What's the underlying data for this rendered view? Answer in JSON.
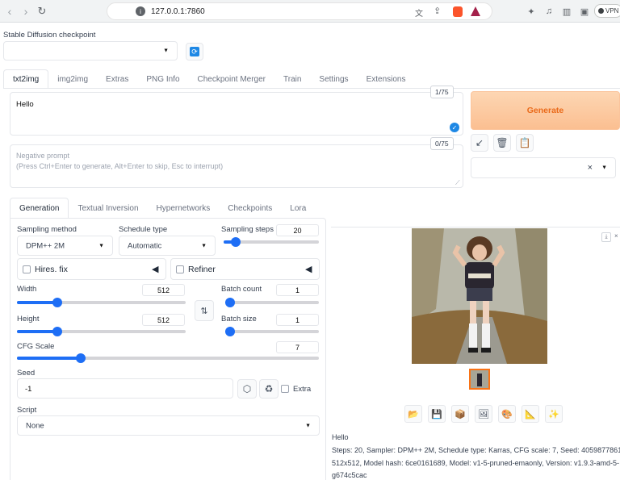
{
  "browser": {
    "url": "127.0.0.1:7860",
    "vpn_label": "VPN"
  },
  "checkpoint": {
    "label": "Stable Diffusion checkpoint",
    "value": ""
  },
  "main_tabs": [
    {
      "label": "txt2img"
    },
    {
      "label": "img2img"
    },
    {
      "label": "Extras"
    },
    {
      "label": "PNG Info"
    },
    {
      "label": "Checkpoint Merger"
    },
    {
      "label": "Train"
    },
    {
      "label": "Settings"
    },
    {
      "label": "Extensions"
    }
  ],
  "prompt": {
    "value": "Hello",
    "counter": "1/75"
  },
  "negative_prompt": {
    "placeholder_line1": "Negative prompt",
    "placeholder_line2": "(Press Ctrl+Enter to generate, Alt+Enter to skip, Esc to interrupt)",
    "counter": "0/75"
  },
  "generate_label": "Generate",
  "style_select": {
    "clear_symbol": "×"
  },
  "sub_tabs": [
    {
      "label": "Generation"
    },
    {
      "label": "Textual Inversion"
    },
    {
      "label": "Hypernetworks"
    },
    {
      "label": "Checkpoints"
    },
    {
      "label": "Lora"
    }
  ],
  "sampling_method": {
    "label": "Sampling method",
    "value": "DPM++ 2M"
  },
  "schedule_type": {
    "label": "Schedule type",
    "value": "Automatic"
  },
  "sampling_steps": {
    "label": "Sampling steps",
    "value": "20",
    "fraction": 0.13
  },
  "hires_fix_label": "Hires. fix",
  "refiner_label": "Refiner",
  "width": {
    "label": "Width",
    "value": "512",
    "fraction": 0.24
  },
  "height": {
    "label": "Height",
    "value": "512",
    "fraction": 0.24
  },
  "batch_count": {
    "label": "Batch count",
    "value": "1",
    "fraction": 0.0
  },
  "batch_size": {
    "label": "Batch size",
    "value": "1",
    "fraction": 0.0
  },
  "cfg_scale": {
    "label": "CFG Scale",
    "value": "7",
    "fraction": 0.21
  },
  "seed": {
    "label": "Seed",
    "value": "-1",
    "extra_label": "Extra"
  },
  "script": {
    "label": "Script",
    "value": "None"
  },
  "output": {
    "info_title": "Hello",
    "info_line1": "Steps: 20, Sampler: DPM++ 2M, Schedule type: Karras, CFG scale: 7, Seed: 4059877861, Size:",
    "info_line2": "512x512, Model hash: 6ce0161689, Model: v1-5-pruned-emaonly, Version: v1.9.3-amd-5-",
    "info_line3": "g674c5cac"
  },
  "colors": {
    "accent": "#1e6ef5",
    "generate_text": "#ea6a1a",
    "generate_bg": "#fcc9a0"
  }
}
